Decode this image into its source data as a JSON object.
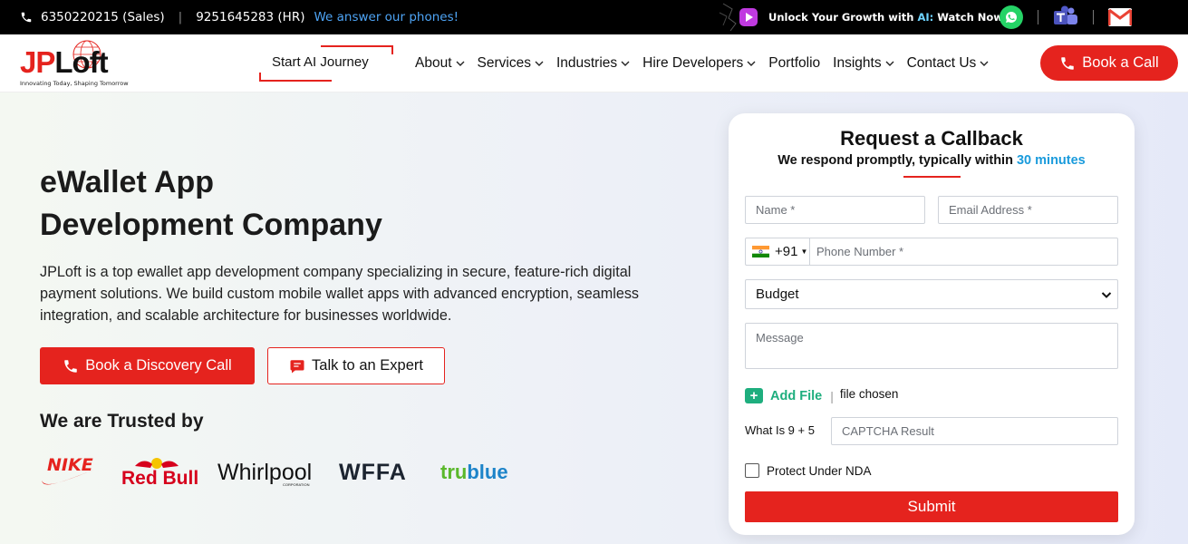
{
  "topbar": {
    "sales_phone": "6350220215 (Sales)",
    "hr_phone": "9251645283 (HR)",
    "answer_note": "We answer our phones!",
    "promo_prefix": "Unlock Your Growth with",
    "promo_ai": "AI:",
    "promo_suffix": "Watch Now",
    "icons": [
      "phone-icon",
      "play-icon",
      "whatsapp-icon",
      "teams-icon",
      "gmail-icon"
    ]
  },
  "nav": {
    "logo_jp": "JP",
    "logo_loft": "Loft",
    "logo_tagline": "Innovating Today, Shaping Tomorrow",
    "ai_journey": "Start AI Journey",
    "items": [
      {
        "label": "About",
        "has_dropdown": true
      },
      {
        "label": "Services",
        "has_dropdown": true
      },
      {
        "label": "Industries",
        "has_dropdown": true
      },
      {
        "label": "Hire Developers",
        "has_dropdown": true
      },
      {
        "label": "Portfolio",
        "has_dropdown": false
      },
      {
        "label": "Insights",
        "has_dropdown": true
      },
      {
        "label": "Contact Us",
        "has_dropdown": true
      }
    ],
    "book_call": "Book a Call"
  },
  "hero": {
    "title_line1": "eWallet App",
    "title_line2": "Development Company",
    "description": "JPLoft is a top ewallet app development company specializing in secure, feature-rich digital payment solutions. We build custom mobile wallet apps with advanced encryption, seamless integration, and scalable architecture for businesses worldwide.",
    "discovery_button": "Book a Discovery Call",
    "expert_button": "Talk to an Expert",
    "trusted_heading": "We are Trusted by",
    "brands": {
      "nike": "NIKE",
      "redbull": "Red Bull",
      "whirlpool": "Whirlpool",
      "whirlpool_sub": "CORPORATION",
      "wffa": "WFFA",
      "trueblue_a": "tru",
      "trueblue_b": "blue"
    }
  },
  "form": {
    "title": "Request a Callback",
    "subtitle_prefix": "We respond promptly, typically within",
    "subtitle_highlight": "30 minutes",
    "name_placeholder": "Name *",
    "email_placeholder": "Email Address *",
    "country_code": "+91",
    "phone_placeholder": "Phone Number *",
    "budget_value": "Budget",
    "message_placeholder": "Message",
    "add_file": "Add File",
    "file_status": "file chosen",
    "captcha_question": "What Is 9 + 5",
    "captcha_placeholder": "CAPTCHA Result",
    "nda_label": "Protect Under NDA",
    "nda_checked": false,
    "submit": "Submit"
  },
  "colors": {
    "brand_red": "#e5231e",
    "accent_blue": "#1a9bdc",
    "file_green": "#1eae7e"
  }
}
